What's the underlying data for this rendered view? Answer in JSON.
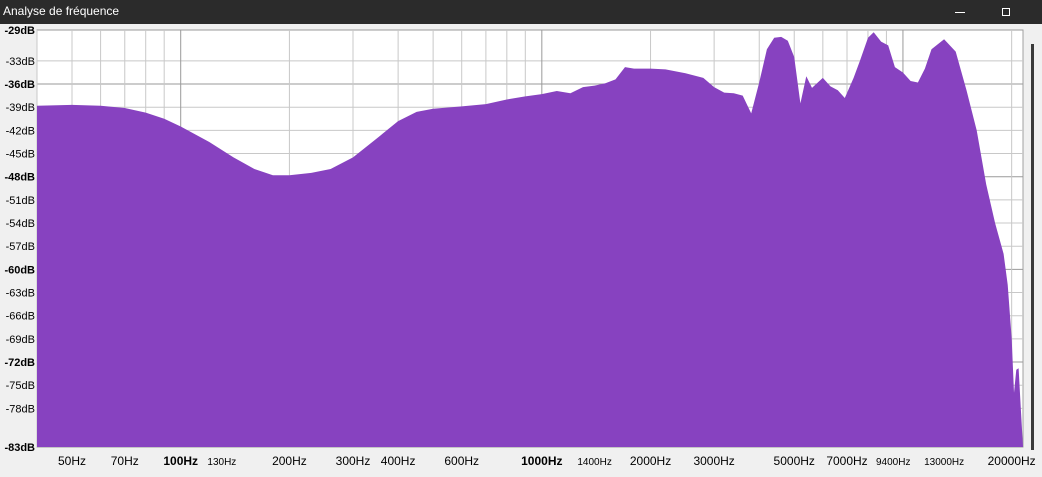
{
  "window": {
    "title": "Analyse de fréquence",
    "buttons": {
      "minimize": "minimize-icon",
      "maximize": "maximize-icon"
    }
  },
  "colors": {
    "fill": "#8742c0",
    "grid": "#c8c8c8",
    "background": "#ffffff",
    "titlebar": "#2b2b2b"
  },
  "chart_data": {
    "type": "area",
    "title": "",
    "xlabel": "",
    "ylabel": "",
    "x_scale": "log",
    "xlim": [
      40,
      21500
    ],
    "ylim": [
      -83,
      -29
    ],
    "grid": true,
    "y_ticks": [
      {
        "value": -29,
        "label": "-29dB",
        "major": true
      },
      {
        "value": -33,
        "label": "-33dB",
        "major": false
      },
      {
        "value": -36,
        "label": "-36dB",
        "major": true
      },
      {
        "value": -39,
        "label": "-39dB",
        "major": false
      },
      {
        "value": -42,
        "label": "-42dB",
        "major": false
      },
      {
        "value": -45,
        "label": "-45dB",
        "major": false
      },
      {
        "value": -48,
        "label": "-48dB",
        "major": true
      },
      {
        "value": -51,
        "label": "-51dB",
        "major": false
      },
      {
        "value": -54,
        "label": "-54dB",
        "major": false
      },
      {
        "value": -57,
        "label": "-57dB",
        "major": false
      },
      {
        "value": -60,
        "label": "-60dB",
        "major": true
      },
      {
        "value": -63,
        "label": "-63dB",
        "major": false
      },
      {
        "value": -66,
        "label": "-66dB",
        "major": false
      },
      {
        "value": -69,
        "label": "-69dB",
        "major": false
      },
      {
        "value": -72,
        "label": "-72dB",
        "major": true
      },
      {
        "value": -75,
        "label": "-75dB",
        "major": false
      },
      {
        "value": -78,
        "label": "-78dB",
        "major": false
      },
      {
        "value": -83,
        "label": "-83dB",
        "major": true
      }
    ],
    "x_ticks": [
      {
        "value": 50,
        "label": "50Hz",
        "style": "normal"
      },
      {
        "value": 70,
        "label": "70Hz",
        "style": "normal"
      },
      {
        "value": 100,
        "label": "100Hz",
        "style": "bold"
      },
      {
        "value": 130,
        "label": "130Hz",
        "style": "small"
      },
      {
        "value": 200,
        "label": "200Hz",
        "style": "normal"
      },
      {
        "value": 300,
        "label": "300Hz",
        "style": "normal"
      },
      {
        "value": 400,
        "label": "400Hz",
        "style": "normal"
      },
      {
        "value": 600,
        "label": "600Hz",
        "style": "normal"
      },
      {
        "value": 1000,
        "label": "1000Hz",
        "style": "bold"
      },
      {
        "value": 1400,
        "label": "1400Hz",
        "style": "small"
      },
      {
        "value": 2000,
        "label": "2000Hz",
        "style": "normal"
      },
      {
        "value": 3000,
        "label": "3000Hz",
        "style": "normal"
      },
      {
        "value": 5000,
        "label": "5000Hz",
        "style": "normal"
      },
      {
        "value": 7000,
        "label": "7000Hz",
        "style": "normal"
      },
      {
        "value": 9400,
        "label": "9400Hz",
        "style": "small"
      },
      {
        "value": 13000,
        "label": "13000Hz",
        "style": "small"
      },
      {
        "value": 20000,
        "label": "20000Hz",
        "style": "normal"
      }
    ],
    "series": [
      {
        "points": [
          [
            40,
            -38.8
          ],
          [
            50,
            -38.7
          ],
          [
            60,
            -38.8
          ],
          [
            70,
            -39.1
          ],
          [
            80,
            -39.7
          ],
          [
            90,
            -40.5
          ],
          [
            100,
            -41.5
          ],
          [
            120,
            -43.5
          ],
          [
            140,
            -45.5
          ],
          [
            160,
            -47.0
          ],
          [
            180,
            -47.8
          ],
          [
            200,
            -47.8
          ],
          [
            230,
            -47.5
          ],
          [
            260,
            -47.0
          ],
          [
            300,
            -45.5
          ],
          [
            350,
            -43.0
          ],
          [
            400,
            -40.8
          ],
          [
            450,
            -39.6
          ],
          [
            500,
            -39.2
          ],
          [
            600,
            -38.9
          ],
          [
            700,
            -38.6
          ],
          [
            800,
            -38.0
          ],
          [
            900,
            -37.6
          ],
          [
            1000,
            -37.3
          ],
          [
            1100,
            -36.9
          ],
          [
            1200,
            -37.2
          ],
          [
            1300,
            -36.4
          ],
          [
            1400,
            -36.2
          ],
          [
            1500,
            -35.9
          ],
          [
            1600,
            -35.4
          ],
          [
            1700,
            -33.8
          ],
          [
            1800,
            -34.0
          ],
          [
            2000,
            -34.0
          ],
          [
            2200,
            -34.1
          ],
          [
            2500,
            -34.6
          ],
          [
            2800,
            -35.2
          ],
          [
            3000,
            -36.4
          ],
          [
            3200,
            -37.1
          ],
          [
            3400,
            -37.2
          ],
          [
            3600,
            -37.5
          ],
          [
            3800,
            -39.8
          ],
          [
            4000,
            -35.8
          ],
          [
            4200,
            -31.5
          ],
          [
            4400,
            -30.0
          ],
          [
            4600,
            -29.9
          ],
          [
            4800,
            -30.4
          ],
          [
            5000,
            -32.5
          ],
          [
            5200,
            -38.5
          ],
          [
            5400,
            -35.0
          ],
          [
            5600,
            -36.5
          ],
          [
            6000,
            -35.2
          ],
          [
            6300,
            -36.3
          ],
          [
            6600,
            -36.8
          ],
          [
            6900,
            -37.8
          ],
          [
            7300,
            -35.2
          ],
          [
            7600,
            -33.0
          ],
          [
            8000,
            -30.0
          ],
          [
            8300,
            -29.3
          ],
          [
            8700,
            -30.5
          ],
          [
            9100,
            -31.0
          ],
          [
            9500,
            -33.8
          ],
          [
            10000,
            -34.5
          ],
          [
            10500,
            -35.6
          ],
          [
            11000,
            -35.8
          ],
          [
            11500,
            -34.0
          ],
          [
            12000,
            -31.5
          ],
          [
            13000,
            -30.2
          ],
          [
            14000,
            -31.8
          ],
          [
            15000,
            -36.8
          ],
          [
            16000,
            -42.0
          ],
          [
            17000,
            -49.0
          ],
          [
            18000,
            -54.0
          ],
          [
            19000,
            -58.0
          ],
          [
            19500,
            -62.0
          ],
          [
            20000,
            -69.0
          ],
          [
            20300,
            -76.0
          ],
          [
            20600,
            -73.0
          ],
          [
            20900,
            -72.8
          ],
          [
            21200,
            -78.0
          ],
          [
            21500,
            -83.0
          ]
        ]
      }
    ]
  }
}
